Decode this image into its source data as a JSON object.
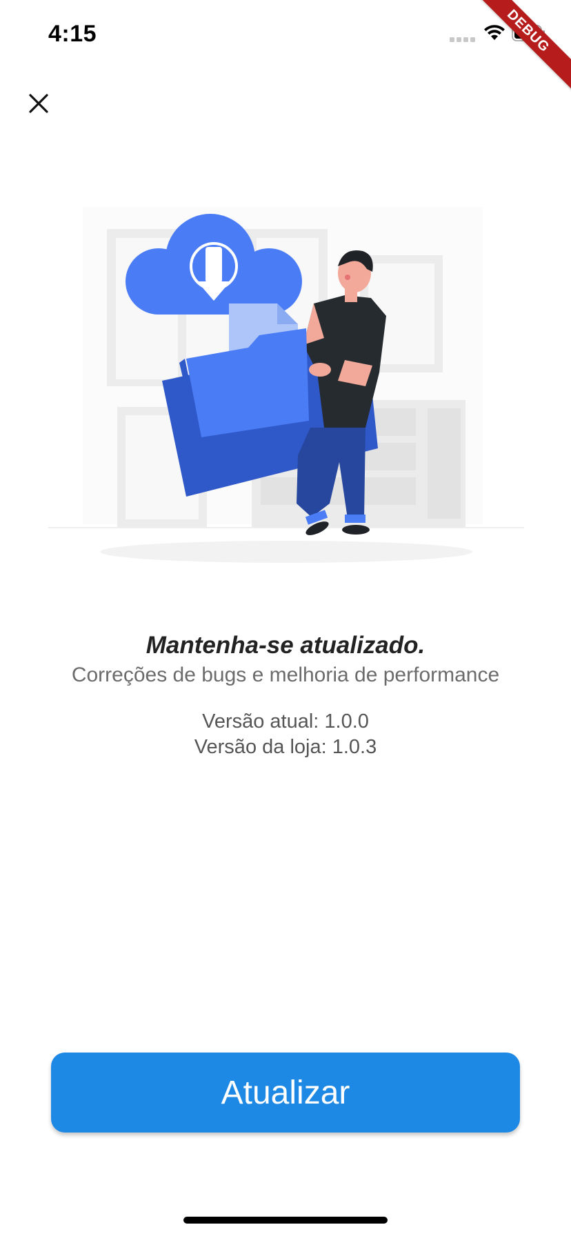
{
  "status_bar": {
    "time": "4:15",
    "icons": [
      "cellular-signal-icon",
      "wifi-icon",
      "battery-icon"
    ]
  },
  "debug_banner": {
    "label": "DEBUG",
    "color": "#b71c1c"
  },
  "close_button": {
    "icon": "close-icon"
  },
  "illustration": {
    "subject": "cloud-download-folder-illustration",
    "accent_color": "#4a7cf5"
  },
  "content": {
    "headline": "Mantenha-se atualizado.",
    "subtitle": "Correções de bugs e melhoria de performance",
    "current_version": "Versão atual: 1.0.0",
    "store_version": "Versão da loja: 1.0.3"
  },
  "update_button": {
    "label": "Atualizar",
    "color": "#1e88e5"
  }
}
